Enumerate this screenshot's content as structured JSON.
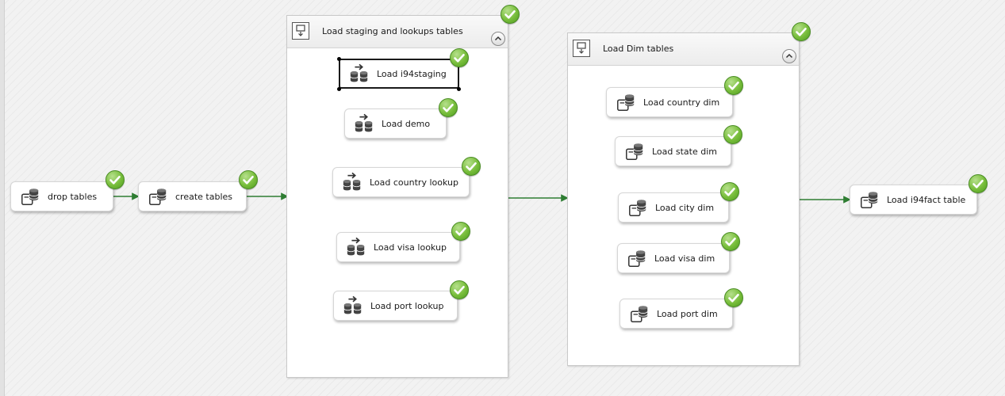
{
  "canvas": {
    "background": "#f2f2f2",
    "arrow_color": "#2e7d32",
    "status": "success"
  },
  "tasks": {
    "drop_tables": {
      "label": "drop tables"
    },
    "create_tables": {
      "label": "create tables"
    },
    "load_i94staging": {
      "label": "Load i94staging"
    },
    "load_demo": {
      "label": "Load demo"
    },
    "load_country_lookup": {
      "label": "Load country lookup"
    },
    "load_visa_lookup": {
      "label": "Load visa lookup"
    },
    "load_port_lookup": {
      "label": "Load port lookup"
    },
    "load_country_dim": {
      "label": "Load country dim"
    },
    "load_state_dim": {
      "label": "Load state dim"
    },
    "load_city_dim": {
      "label": "Load city dim"
    },
    "load_visa_dim": {
      "label": "Load visa dim"
    },
    "load_port_dim": {
      "label": "Load port dim"
    },
    "load_i94fact": {
      "label": "Load i94fact table"
    }
  },
  "containers": {
    "staging": {
      "title": "Load staging and lookups tables"
    },
    "dims": {
      "title": "Load Dim tables"
    }
  },
  "icons": {
    "sql_task": "execute-sql-task-icon",
    "dataflow_task": "data-flow-task-icon",
    "container": "sequence-container-icon",
    "success": "success-check-icon",
    "collapse": "collapse-chevron-icon"
  }
}
